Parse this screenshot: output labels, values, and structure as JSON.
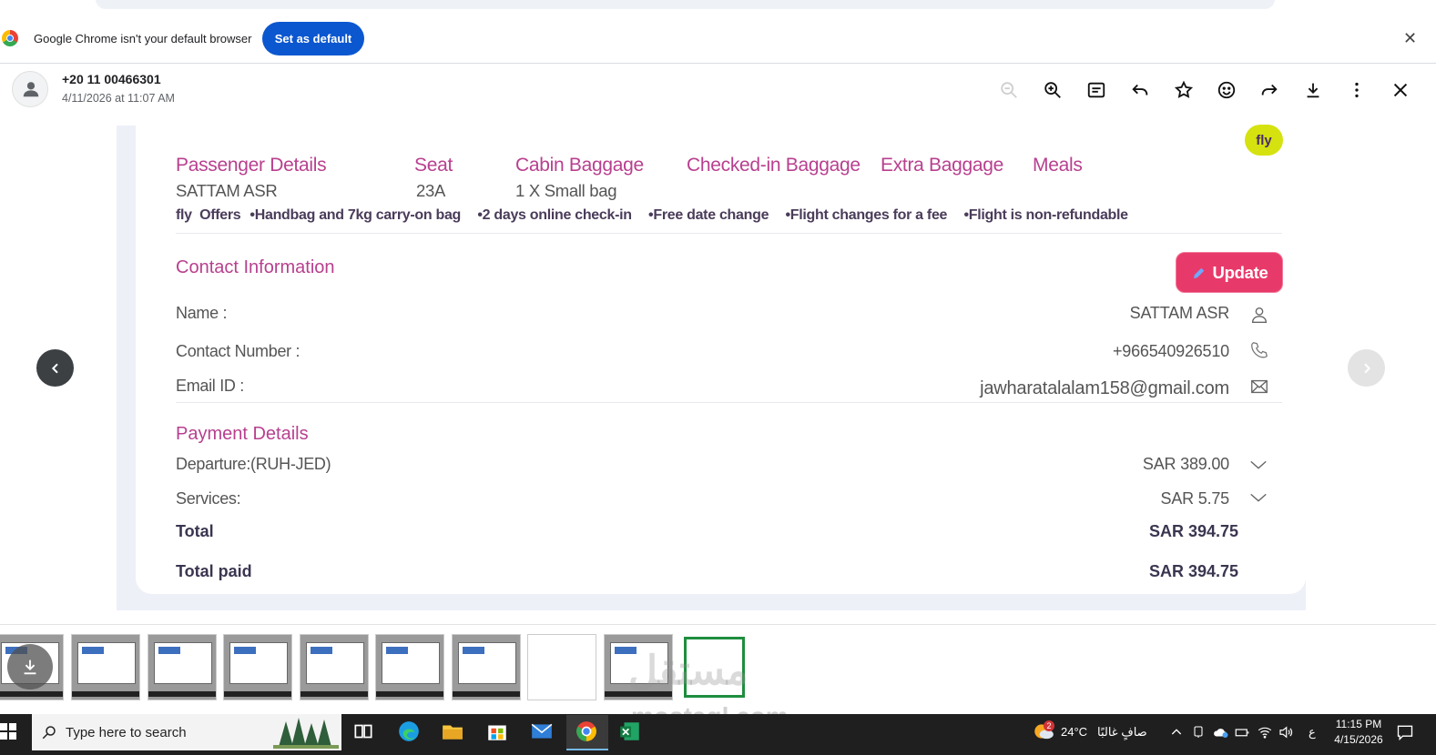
{
  "infobar": {
    "message": "Google Chrome isn't your default browser",
    "button": "Set as default",
    "close": "✕"
  },
  "viewer": {
    "sender": "+20 11 00466301",
    "timestamp": "4/11/2026 at 11:07 AM",
    "tools": [
      "zoom-out-icon",
      "zoom-in-icon",
      "caption-icon",
      "reply-icon",
      "star-icon",
      "emoji-icon",
      "forward-icon",
      "download-icon",
      "more-icon",
      "close-icon"
    ]
  },
  "booking": {
    "badge": "fly",
    "columns": {
      "passenger_label": "Passenger Details",
      "seat_label": "Seat",
      "cabin_label": "Cabin Baggage",
      "checked_label": "Checked-in Baggage",
      "extra_label": "Extra Baggage",
      "meals_label": "Meals",
      "passenger_value": "SATTAM ASR",
      "seat_value": "23A",
      "cabin_value": "1 X Small bag"
    },
    "offers": {
      "brand": "fly",
      "title": "Offers",
      "items": [
        "Handbag and 7kg carry-on bag",
        "2 days online check-in",
        "Free date change",
        "Flight changes for a fee",
        "Flight is non-refundable"
      ]
    },
    "contact": {
      "title": "Contact Information",
      "update_button": "Update",
      "name_label": "Name :",
      "name_value": "SATTAM ASR",
      "phone_label": "Contact Number :",
      "phone_value": "+966540926510",
      "email_label": "Email ID :",
      "email_value": "jawharatalalam158@gmail.com"
    },
    "payment": {
      "title": "Payment Details",
      "departure_label": "Departure:(RUH-JED)",
      "departure_value": "SAR 389.00",
      "services_label": "Services:",
      "services_value": "SAR 5.75",
      "total_label": "Total",
      "total_value": "SAR 394.75",
      "paid_label": "Total paid",
      "paid_value": "SAR 394.75"
    }
  },
  "watermark": {
    "arabic": "مستقل",
    "latin": "mostaql.com"
  },
  "taskbar": {
    "search_placeholder": "Type here to search",
    "temperature": "24°C",
    "weather": "صافٍ غالبًا",
    "language": "ع",
    "weather_badge": "2",
    "time": "11:15 PM",
    "date": "4/15/2026"
  },
  "colors": {
    "accent": "#b8408f",
    "update": "#e83a6a",
    "badge": "#d5e20f",
    "chrome_button": "#0b57d0"
  }
}
